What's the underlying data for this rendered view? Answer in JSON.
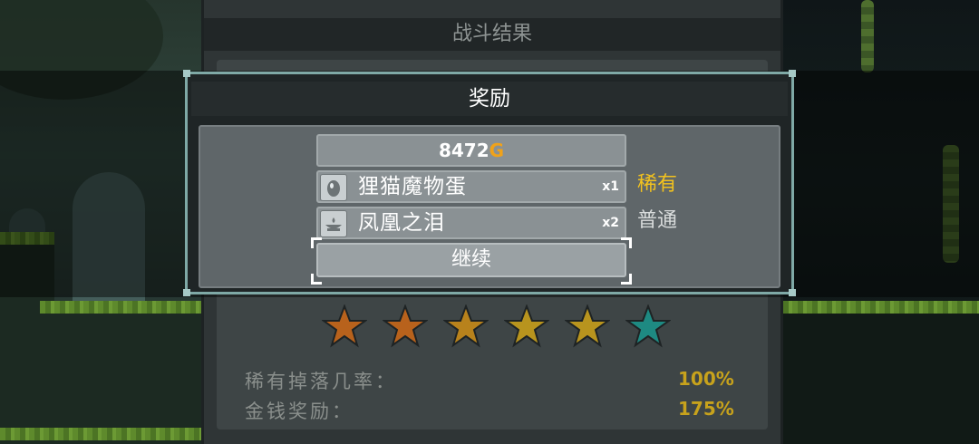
{
  "battle_result": {
    "title": "战斗结果",
    "stars": [
      {
        "color": "#b8621c"
      },
      {
        "color": "#b8621c"
      },
      {
        "color": "#b8821c"
      },
      {
        "color": "#b8941e"
      },
      {
        "color": "#b8941e"
      },
      {
        "color": "#1e8a82"
      }
    ],
    "stats": [
      {
        "label": "稀有掉落几率：",
        "value": "100%"
      },
      {
        "label": "金钱奖励：",
        "value": "175%"
      }
    ]
  },
  "reward": {
    "title": "奖励",
    "gold_amount": "8472",
    "gold_unit": "G",
    "items": [
      {
        "icon": "egg-icon",
        "name": "狸猫魔物蛋",
        "qty": "x1",
        "rarity": "稀有",
        "rarity_color": "#f2c21e"
      },
      {
        "icon": "lamp-icon",
        "name": "凤凰之泪",
        "qty": "x2",
        "rarity": "普通",
        "rarity_color": "#d9dcdc"
      }
    ],
    "continue_label": "继续"
  }
}
